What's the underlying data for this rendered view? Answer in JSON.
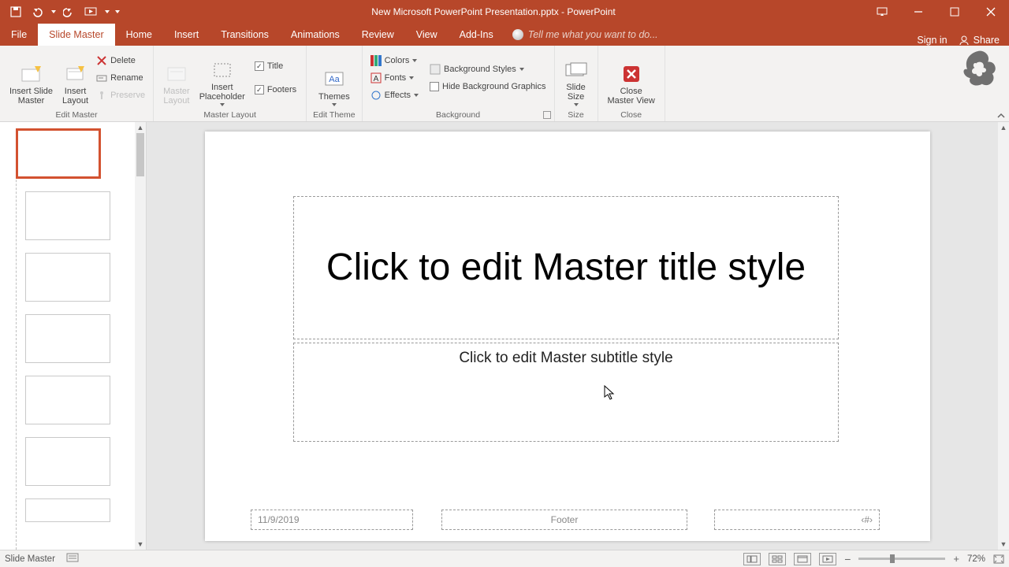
{
  "app": {
    "title": "New Microsoft PowerPoint Presentation.pptx - PowerPoint"
  },
  "qat": {
    "save": "Save",
    "undo": "Undo",
    "redo": "Redo",
    "start": "Start From Beginning",
    "customize": "Customize"
  },
  "win": {
    "opts": "Ribbon Display Options",
    "min": "Minimize",
    "max": "Restore",
    "close": "Close"
  },
  "tabs": {
    "file": "File",
    "slidemaster": "Slide Master",
    "home": "Home",
    "insert": "Insert",
    "transitions": "Transitions",
    "animations": "Animations",
    "review": "Review",
    "view": "View",
    "addins": "Add-Ins",
    "tellme": "Tell me what you want to do...",
    "signin": "Sign in",
    "share": "Share"
  },
  "ribbon": {
    "editmaster": {
      "group": "Edit Master",
      "insertslidemaster": "Insert Slide\nMaster",
      "insertlayout": "Insert\nLayout",
      "delete": "Delete",
      "rename": "Rename",
      "preserve": "Preserve"
    },
    "masterlayout": {
      "group": "Master Layout",
      "masterlayout": "Master\nLayout",
      "insertplaceholder": "Insert\nPlaceholder",
      "title": "Title",
      "footers": "Footers"
    },
    "edittheme": {
      "group": "Edit Theme",
      "themes": "Themes"
    },
    "background": {
      "group": "Background",
      "colors": "Colors",
      "fonts": "Fonts",
      "effects": "Effects",
      "bgstyles": "Background Styles",
      "hidebg": "Hide Background Graphics"
    },
    "size": {
      "group": "Size",
      "slidesize": "Slide\nSize"
    },
    "close": {
      "group": "Close",
      "closemaster": "Close\nMaster View"
    }
  },
  "slide": {
    "title": "Click to edit Master title style",
    "subtitle": "Click to edit Master subtitle style",
    "date": "11/9/2019",
    "footer": "Footer",
    "num": "‹#›"
  },
  "status": {
    "mode": "Slide Master",
    "zoom": "72%"
  }
}
